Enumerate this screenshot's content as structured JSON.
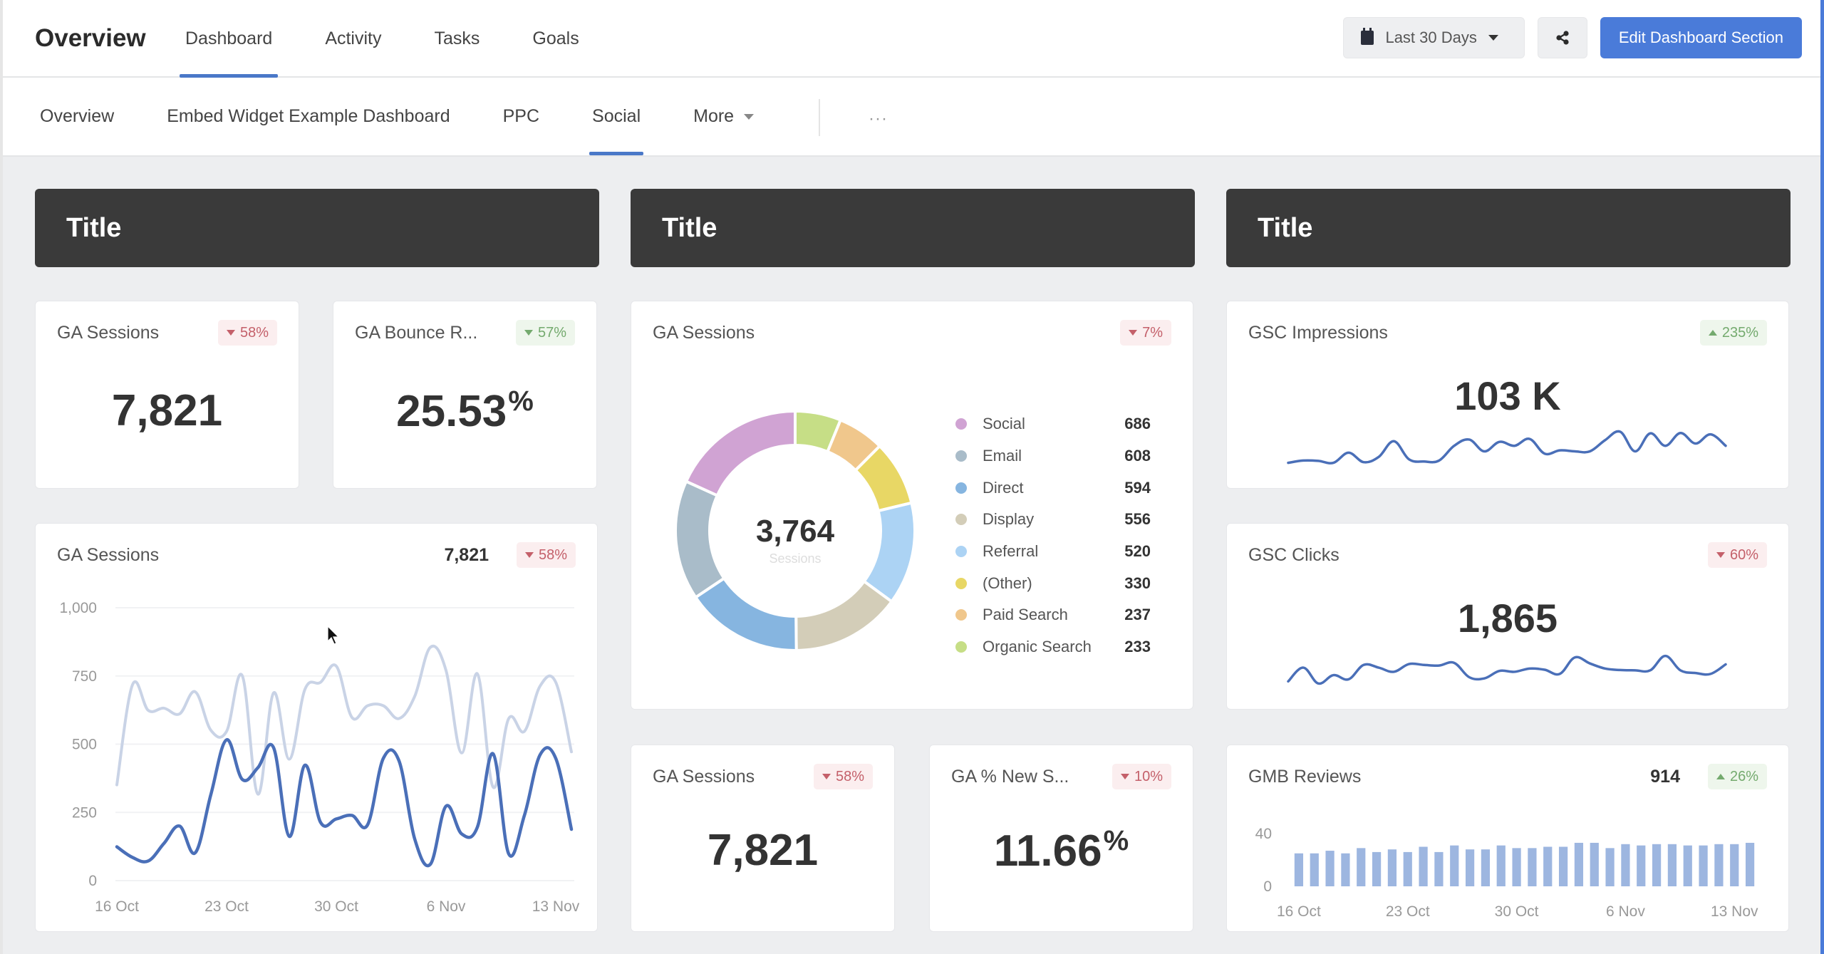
{
  "header": {
    "title": "Overview",
    "tabs": [
      {
        "label": "Dashboard",
        "active": true
      },
      {
        "label": "Activity",
        "active": false
      },
      {
        "label": "Tasks",
        "active": false
      },
      {
        "label": "Goals",
        "active": false
      }
    ],
    "date_range": "Last 30 Days",
    "share_icon": "share-icon",
    "calendar_icon": "calendar-icon",
    "edit_button": "Edit Dashboard Section"
  },
  "subnav": {
    "tabs": [
      {
        "label": "Overview",
        "active": false
      },
      {
        "label": "Embed Widget Example Dashboard",
        "active": false
      },
      {
        "label": "PPC",
        "active": false
      },
      {
        "label": "Social",
        "active": true
      },
      {
        "label": "More",
        "active": false
      }
    ],
    "overflow_icon": "···"
  },
  "colors": {
    "accent": "#4a7bd9",
    "title_bar": "#3a3a3a",
    "badge_down": "#c4606a",
    "badge_up": "#74aa6e",
    "line_current": "#4a6fb8",
    "line_previous": "#c9d3e6",
    "bar": "#9db6e0"
  },
  "sections": [
    {
      "title": "Title"
    },
    {
      "title": "Title"
    },
    {
      "title": "Title"
    }
  ],
  "widgets": {
    "ga_sessions_kpi": {
      "title": "GA Sessions",
      "value": "7,821",
      "change": "58%",
      "direction": "down"
    },
    "ga_bounce_rate": {
      "title": "GA Bounce R...",
      "value": "25.53",
      "unit": "%",
      "change": "57%",
      "direction": "down"
    },
    "ga_sessions_line": {
      "title": "GA Sessions",
      "value": "7,821",
      "change": "58%",
      "direction": "down"
    },
    "ga_sessions_donut": {
      "title": "GA Sessions",
      "change": "7%",
      "direction": "down",
      "center_value": "3,764",
      "center_label": "Sessions"
    },
    "ga_sessions_kpi2": {
      "title": "GA Sessions",
      "value": "7,821",
      "change": "58%",
      "direction": "down"
    },
    "ga_new_sessions": {
      "title": "GA % New S...",
      "value": "11.66",
      "unit": "%",
      "change": "10%",
      "direction": "down"
    },
    "gsc_impressions": {
      "title": "GSC Impressions",
      "value": "103 K",
      "change": "235%",
      "direction": "up"
    },
    "gsc_clicks": {
      "title": "GSC Clicks",
      "value": "1,865",
      "change": "60%",
      "direction": "down"
    },
    "gmb_reviews": {
      "title": "GMB Reviews",
      "value": "914",
      "change": "26%",
      "direction": "up"
    }
  },
  "chart_data": [
    {
      "id": "ga_sessions_line",
      "type": "line",
      "title": "GA Sessions",
      "x_tick_labels": [
        "16 Oct",
        "23 Oct",
        "30 Oct",
        "6 Nov",
        "13 Nov"
      ],
      "x_tick_indices": [
        0,
        7,
        14,
        21,
        28
      ],
      "y_tick_labels": [
        "0",
        "250",
        "500",
        "750",
        "1,000"
      ],
      "y_ticks": [
        0,
        250,
        500,
        750,
        1000
      ],
      "ylim": [
        0,
        1000
      ],
      "grid": true,
      "series": [
        {
          "name": "Previous period",
          "values": [
            351,
            718,
            624,
            632,
            611,
            692,
            551,
            547,
            751,
            317,
            688,
            445,
            701,
            727,
            786,
            598,
            641,
            641,
            594,
            675,
            855,
            770,
            468,
            758,
            343,
            594,
            547,
            713,
            727,
            472
          ]
        },
        {
          "name": "Current period",
          "values": [
            124,
            85,
            72,
            136,
            200,
            102,
            316,
            516,
            371,
            414,
            487,
            162,
            423,
            213,
            226,
            239,
            205,
            448,
            439,
            153,
            60,
            273,
            171,
            196,
            465,
            98,
            239,
            461,
            448,
            188
          ]
        }
      ]
    },
    {
      "id": "ga_sessions_donut",
      "type": "pie",
      "title": "GA Sessions",
      "total": 3764,
      "categories": [
        "Social",
        "Email",
        "Direct",
        "Display",
        "Referral",
        "(Other)",
        "Paid Search",
        "Organic Search"
      ],
      "values": [
        686,
        608,
        594,
        556,
        520,
        330,
        237,
        233
      ],
      "colors": [
        "#d0a3d3",
        "#a9bcc9",
        "#86b5e0",
        "#d3cdb8",
        "#acd3f4",
        "#e8d765",
        "#f0c78c",
        "#c6de86"
      ]
    },
    {
      "id": "gsc_impressions_sparkline",
      "type": "line",
      "title": "GSC Impressions",
      "values": [
        3,
        10,
        9,
        3,
        34,
        5,
        21,
        69,
        14,
        7,
        10,
        55,
        74,
        38,
        67,
        55,
        76,
        31,
        41,
        38,
        38,
        72,
        98,
        38,
        93,
        55,
        94,
        62,
        90,
        55
      ]
    },
    {
      "id": "gsc_clicks_sparkline",
      "type": "line",
      "title": "GSC Clicks",
      "values": [
        11,
        57,
        4,
        32,
        18,
        66,
        57,
        43,
        69,
        66,
        64,
        73,
        25,
        21,
        46,
        43,
        54,
        50,
        36,
        91,
        71,
        54,
        49,
        48,
        48,
        96,
        48,
        39,
        36,
        68
      ]
    },
    {
      "id": "gmb_reviews_bar",
      "type": "bar",
      "title": "GMB Reviews",
      "x_tick_labels": [
        "16 Oct",
        "23 Oct",
        "30 Oct",
        "6 Nov",
        "13 Nov"
      ],
      "x_tick_indices": [
        0,
        7,
        14,
        21,
        28
      ],
      "y_tick_labels": [
        "0",
        "40"
      ],
      "y_ticks": [
        0,
        40
      ],
      "ylim": [
        0,
        40
      ],
      "values": [
        25,
        25,
        27,
        25,
        29,
        26,
        28,
        26,
        30,
        26,
        31,
        28,
        28,
        31,
        29,
        29,
        30,
        30,
        33,
        33,
        29,
        32,
        31,
        32,
        32,
        31,
        31,
        32,
        32,
        33
      ]
    }
  ]
}
